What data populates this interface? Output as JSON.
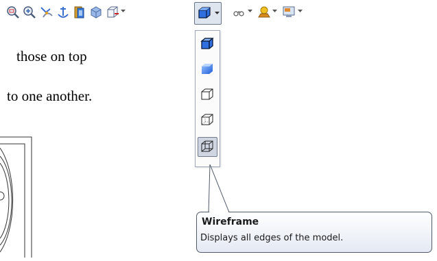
{
  "document": {
    "line1": "those on top",
    "line2": "to one another."
  },
  "toolbar": {
    "icons": [
      "zoom-to-area-icon",
      "zoom-in-out-icon",
      "rotate-view-icon",
      "section-view-icon",
      "view-orientation-icon",
      "3d-box-icon",
      "hide-show-items-icon",
      "display-style-icon",
      "edit-appearance-icon",
      "apply-scene-icon",
      "view-settings-icon"
    ]
  },
  "display_style_menu": {
    "items": [
      {
        "name": "Shaded With Edges",
        "selected": false
      },
      {
        "name": "Shaded",
        "selected": false
      },
      {
        "name": "Hidden Lines Removed",
        "selected": false
      },
      {
        "name": "Hidden Lines Visible",
        "selected": false
      },
      {
        "name": "Wireframe",
        "selected": true
      }
    ]
  },
  "tooltip": {
    "title": "Wireframe",
    "description": "Displays all edges of the model."
  },
  "colors": {
    "accent_blue": "#2f6fe0",
    "selection_bg": "#cfd6e2",
    "menu_border": "#9da7b8"
  }
}
